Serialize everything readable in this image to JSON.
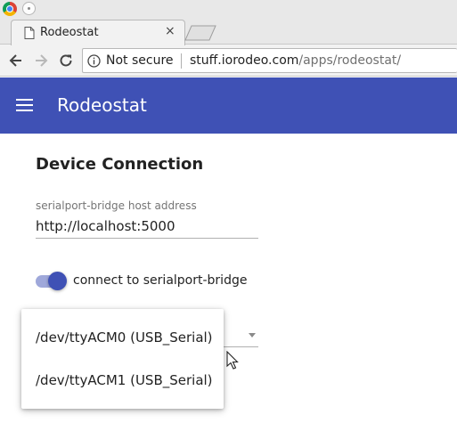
{
  "browser": {
    "tab_title": "Rodeostat",
    "tab_close_glyph": "×",
    "security_label": "Not secure",
    "url_host": "stuff.iorodeo.com",
    "url_path": "/apps/rodeostat/"
  },
  "icons": {
    "back": "arrow-left-icon",
    "forward": "arrow-right-icon",
    "reload": "reload-icon",
    "info": "info-icon",
    "menu": "hamburger-menu-icon",
    "page": "page-icon"
  },
  "app": {
    "title": "Rodeostat",
    "accent": "#3f51b5"
  },
  "device_connection": {
    "heading": "Device Connection",
    "host_label": "serialport-bridge host address",
    "host_value": "http://localhost:5000",
    "toggle_label": "connect to serialport-bridge",
    "toggle_on": true,
    "port_options": [
      "/dev/ttyACM0 (USB_Serial)",
      "/dev/ttyACM1 (USB_Serial)"
    ]
  }
}
